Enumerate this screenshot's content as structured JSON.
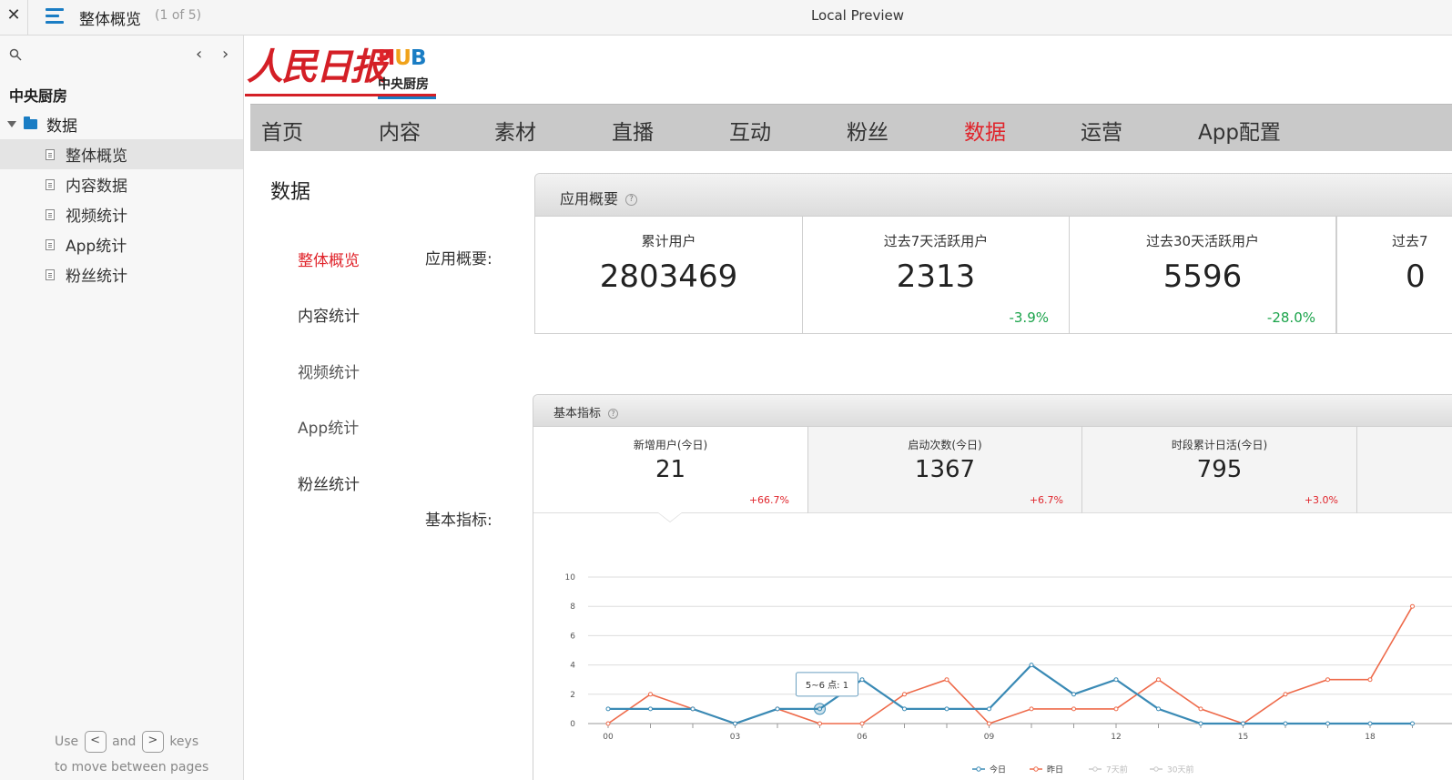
{
  "window": {
    "close_glyph": "✕",
    "doc_title": "整体概览",
    "page_count": "(1 of 5)",
    "app_title": "Local Preview"
  },
  "sidebar": {
    "prev_glyph": "‹",
    "next_glyph": "›",
    "root": "中央厨房",
    "folder": "数据",
    "items": [
      {
        "label": "整体概览",
        "active": true
      },
      {
        "label": "内容数据"
      },
      {
        "label": "视频统计"
      },
      {
        "label": "App统计"
      },
      {
        "label": "粉丝统计"
      }
    ],
    "footer": {
      "use": "Use",
      "key_prev": "<",
      "and": "and",
      "key_next": ">",
      "keys": "keys",
      "line2": "to move between pages"
    }
  },
  "brand": {
    "logo_text": "人民日报",
    "hub": "HUB",
    "sub": "中央厨房",
    "colors": {
      "red": "#d41f26",
      "blue": "#1a7dc4"
    }
  },
  "nav": {
    "items": [
      "首页",
      "内容",
      "素材",
      "直播",
      "互动",
      "粉丝",
      "数据",
      "运营",
      "App配置"
    ],
    "active": "数据"
  },
  "page": {
    "heading": "数据",
    "side_links": [
      "整体概览",
      "内容统计",
      "视频统计",
      "App统计",
      "粉丝统计"
    ],
    "active_link": "整体概览",
    "section_overview_label": "应用概要:",
    "section_basic_label": "基本指标:"
  },
  "overview": {
    "title": "应用概要",
    "cards": [
      {
        "label": "累计用户",
        "value": "2803469",
        "change": ""
      },
      {
        "label": "过去7天活跃用户",
        "value": "2313",
        "change": "-3.9%"
      },
      {
        "label": "过去30天活跃用户",
        "value": "5596",
        "change": "-28.0%"
      },
      {
        "label": "过去7",
        "value": "0",
        "change": ""
      }
    ]
  },
  "basic": {
    "title": "基本指标",
    "cards": [
      {
        "label": "新增用户(今日)",
        "value": "21",
        "change": "+66.7%"
      },
      {
        "label": "启动次数(今日)",
        "value": "1367",
        "change": "+6.7%"
      },
      {
        "label": "时段累计日活(今日)",
        "value": "795",
        "change": "+3.0%"
      }
    ]
  },
  "chart_data": {
    "type": "line",
    "x": [
      "00",
      "01",
      "02",
      "03",
      "04",
      "05",
      "06",
      "07",
      "08",
      "09",
      "10",
      "11",
      "12",
      "13",
      "14",
      "15",
      "16",
      "17",
      "18",
      "19"
    ],
    "xticks": [
      "00",
      "03",
      "06",
      "09",
      "12",
      "15",
      "18"
    ],
    "ylim": [
      0,
      10
    ],
    "yticks": [
      "0",
      "2",
      "4",
      "6",
      "8",
      "10"
    ],
    "series": [
      {
        "name": "今日",
        "color": "#3a8ab5",
        "values": [
          1,
          1,
          1,
          0,
          1,
          1,
          3,
          1,
          1,
          1,
          4,
          2,
          3,
          1,
          0,
          0,
          0,
          0,
          0,
          0
        ]
      },
      {
        "name": "昨日",
        "color": "#ee6a4a",
        "values": [
          0,
          2,
          1,
          0,
          1,
          0,
          0,
          2,
          3,
          0,
          1,
          1,
          1,
          3,
          1,
          0,
          2,
          3,
          3,
          8
        ]
      },
      {
        "name": "7天前",
        "color": "#c9c9c9",
        "values": []
      },
      {
        "name": "30天前",
        "color": "#c9c9c9",
        "values": []
      }
    ],
    "tooltip": {
      "text": "5~6 点: 1",
      "x_index": 5,
      "series": "今日"
    }
  }
}
